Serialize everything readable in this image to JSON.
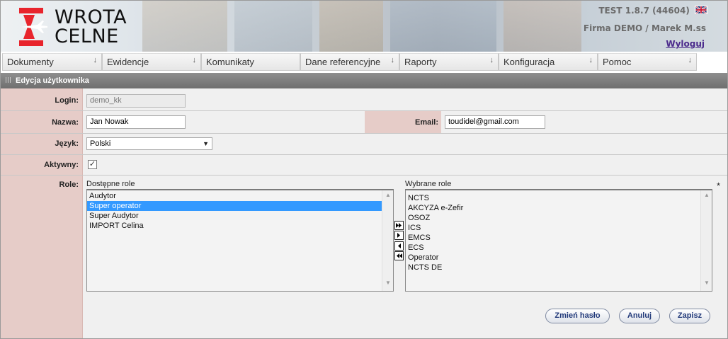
{
  "header": {
    "logo_line1": "WROTA",
    "logo_line2": "CELNE",
    "version": "TEST  1.8.7 (44604)",
    "company_user": "Firma DEMO / Marek M.ss",
    "logout": "Wyloguj",
    "flag_icon": "uk-flag-icon"
  },
  "menu": [
    {
      "label": "Dokumenty",
      "has_dropdown": true
    },
    {
      "label": "Ewidencje",
      "has_dropdown": true
    },
    {
      "label": "Komunikaty",
      "has_dropdown": false
    },
    {
      "label": "Dane referencyjne",
      "has_dropdown": true
    },
    {
      "label": "Raporty",
      "has_dropdown": true
    },
    {
      "label": "Konfiguracja",
      "has_dropdown": true
    },
    {
      "label": "Pomoc",
      "has_dropdown": true
    }
  ],
  "section_title": "Edycja użytkownika",
  "form": {
    "login_label": "Login:",
    "login_value": "demo_kk",
    "name_label": "Nazwa:",
    "name_value": "Jan Nowak",
    "email_label": "Email:",
    "email_value": "toudidel@gmail.com",
    "language_label": "Język:",
    "language_value": "Polski",
    "active_label": "Aktywny:",
    "active_checked": true,
    "active_mark": "✓",
    "roles_label": "Role:",
    "required_mark": "*"
  },
  "roles": {
    "available_title": "Dostępne role",
    "available": [
      "Audytor",
      "Super operator",
      "Super Audytor",
      "IMPORT Celina"
    ],
    "available_selected": "Super operator",
    "chosen_title": "Wybrane role",
    "chosen": [
      "NCTS",
      "AKCYZA e-Zefir",
      "OSOZ",
      "ICS",
      "EMCS",
      "ECS",
      "Operator",
      "NCTS DE"
    ]
  },
  "buttons": {
    "change_password": "Zmień hasło",
    "cancel": "Anuluj",
    "save": "Zapisz"
  },
  "colors": {
    "label_column": "#e6ccc8",
    "section_bar": "#7f7f7f",
    "logo_red": "#e8242c",
    "selected_option": "#3399ff"
  }
}
